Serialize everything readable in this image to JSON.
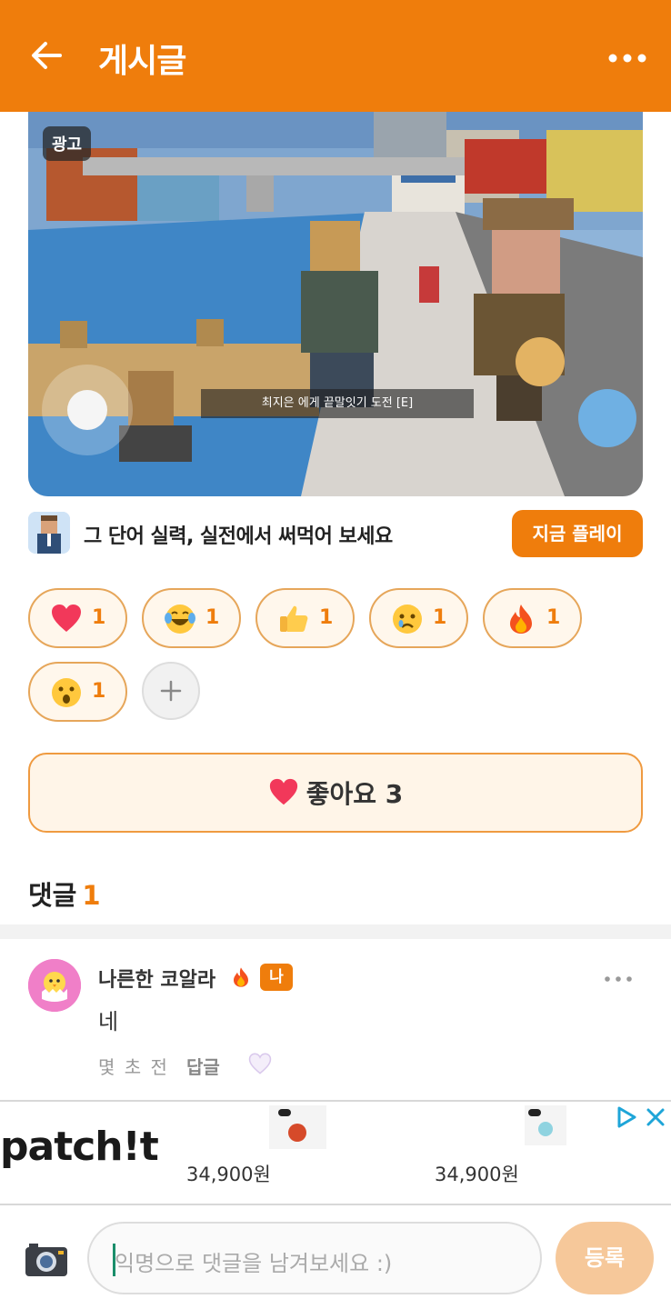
{
  "header": {
    "title": "게시글",
    "back_icon": "back-arrow-icon",
    "more_icon": "more-horizontal-icon"
  },
  "ad": {
    "label": "광고",
    "caption": "최지은 에게 끝말잇기 도전 [E]",
    "headline": "그 단어 실력, 실전에서 써먹어 보세요",
    "cta": "지금 플레이"
  },
  "reactions": [
    {
      "emoji": "heart",
      "count": "1"
    },
    {
      "emoji": "laughing-tears",
      "count": "1"
    },
    {
      "emoji": "thumbs-up",
      "count": "1"
    },
    {
      "emoji": "crying-face",
      "count": "1"
    },
    {
      "emoji": "fire",
      "count": "1"
    },
    {
      "emoji": "surprised-face",
      "count": "1"
    }
  ],
  "like": {
    "label": "좋아요 3"
  },
  "comments": {
    "title": "댓글",
    "count": "1",
    "items": [
      {
        "author": "나른한 코알라",
        "badge": "나",
        "text": "네",
        "time": "몇 초 전",
        "reply": "답글"
      }
    ]
  },
  "banner": {
    "brand": "patch!t",
    "price1": "34,900원",
    "price2": "34,900원"
  },
  "composer": {
    "placeholder": "익명으로 댓글을 남겨보세요 :)",
    "submit": "등록"
  },
  "colors": {
    "primary": "#ef7d0c",
    "pill_border": "#e6a65a",
    "pill_bg": "#fff7ec"
  }
}
